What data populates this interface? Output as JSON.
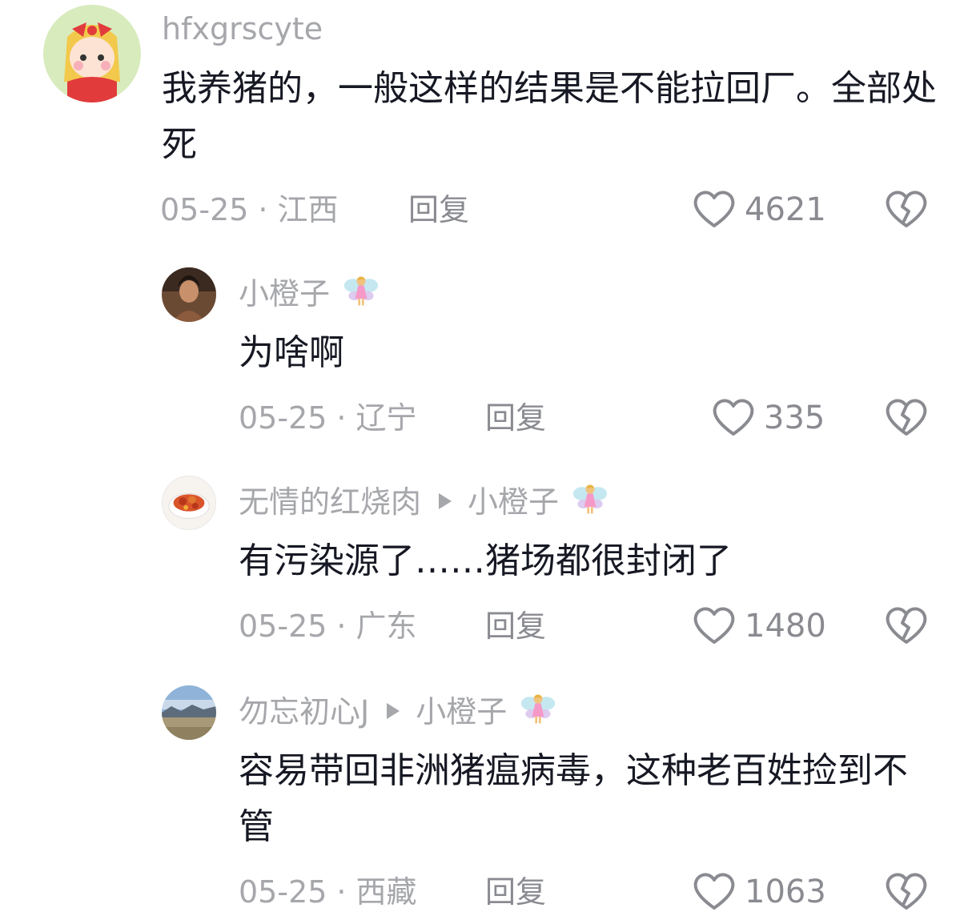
{
  "colors": {
    "primary_text": "#161823",
    "secondary_text": "#a6a7ab",
    "action_text": "#8a8b91",
    "icon": "#8a8b91"
  },
  "comments": [
    {
      "username": "hfxgrscyte",
      "text": "我养猪的，一般这样的结果是不能拉回厂。全部处死",
      "date": "05-25",
      "location": "江西",
      "reply_label": "回复",
      "likes": "4621",
      "avatar_icon": "cartoon-girl-avatar"
    },
    {
      "username": "小橙子",
      "username_badge": "fairy-emoji-icon",
      "text": "为啥啊",
      "date": "05-25",
      "location": "辽宁",
      "reply_label": "回复",
      "likes": "335",
      "avatar_icon": "woman-portrait-avatar"
    },
    {
      "username": "无情的红烧肉",
      "reply_to": "小橙子",
      "text": "有污染源了……猪场都很封闭了",
      "date": "05-25",
      "location": "广东",
      "reply_label": "回复",
      "likes": "1480",
      "avatar_icon": "braised-pork-dish-avatar"
    },
    {
      "username": "勿忘初心J",
      "reply_to": "小橙子",
      "text": "容易带回非洲猪瘟病毒，这种老百姓捡到不管",
      "date": "05-25",
      "location": "西藏",
      "reply_label": "回复",
      "likes": "1063",
      "avatar_icon": "landscape-avatar"
    }
  ]
}
